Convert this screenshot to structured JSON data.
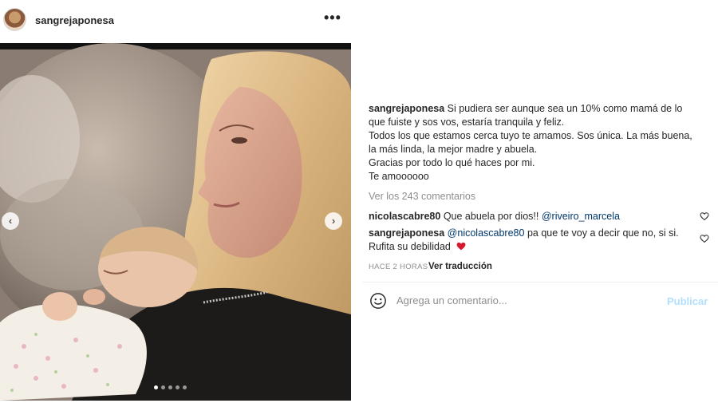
{
  "post": {
    "username": "sangrejaponesa",
    "more_icon": "ellipsis-icon",
    "carousel": {
      "dot_count": 5,
      "active_index": 0
    }
  },
  "caption": {
    "username": "sangrejaponesa",
    "lines": [
      "Si pudiera ser aunque sea un 10% como mamá de lo",
      "que fuiste y sos vos, estaría tranquila y feliz.",
      "Todos los que estamos cerca tuyo te amamos. Sos única. La más buena,",
      "la más linda, la mejor madre y abuela.",
      "Gracias por todo lo qué haces por mi.",
      "Te amoooooo"
    ]
  },
  "view_comments": "Ver los 243 comentarios",
  "comments": [
    {
      "username": "nicolascabre80",
      "text": "Que abuela por dios!!",
      "mention": "@riveiro_marcela"
    },
    {
      "username": "sangrejaponesa",
      "mention": "@nicolascabre80",
      "text": "pa que te voy a decir que no, si si.",
      "text2": "Rufita su debilidad"
    }
  ],
  "meta": {
    "time": "HACE 2 HORAS",
    "translate": "Ver traducción"
  },
  "composer": {
    "placeholder": "Agrega un comentario...",
    "publish": "Publicar"
  },
  "colors": {
    "link": "#00376b",
    "muted": "#8e8e8e",
    "publish_disabled": "#b2dffc",
    "heart_red": "#ed4956"
  }
}
